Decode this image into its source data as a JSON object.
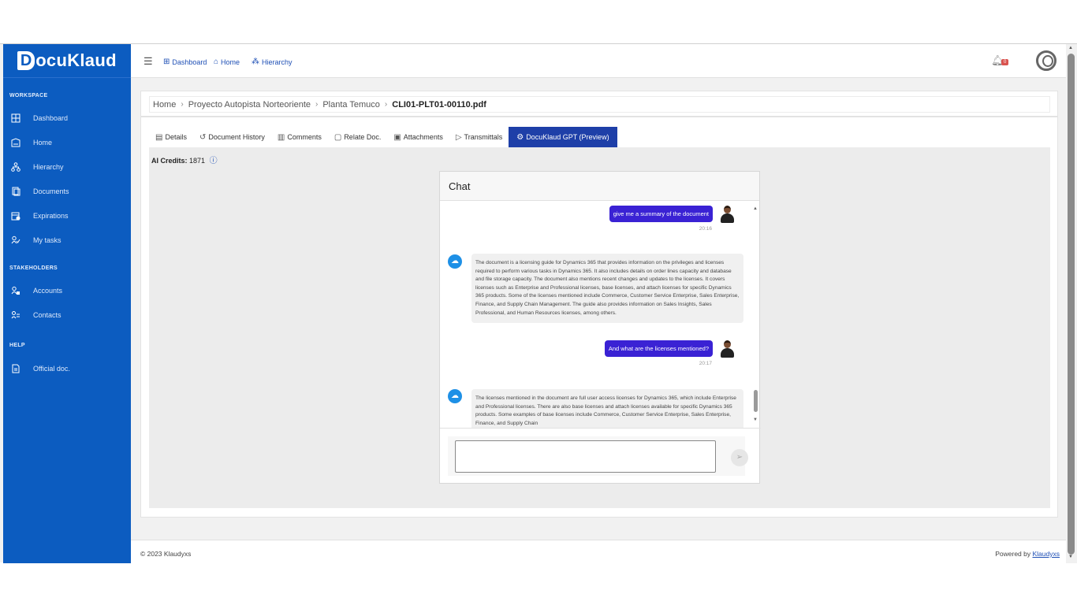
{
  "brand": {
    "name": "DocuKlaud",
    "initial": "D",
    "rest": "ocuKlaud"
  },
  "sidebar": {
    "sections": [
      {
        "title": "WORKSPACE",
        "items": [
          {
            "label": "Dashboard",
            "icon": "dashboard-icon"
          },
          {
            "label": "Home",
            "icon": "home-icon"
          },
          {
            "label": "Hierarchy",
            "icon": "hierarchy-icon"
          },
          {
            "label": "Documents",
            "icon": "documents-icon"
          },
          {
            "label": "Expirations",
            "icon": "expirations-icon"
          },
          {
            "label": "My tasks",
            "icon": "tasks-icon"
          }
        ]
      },
      {
        "title": "STAKEHOLDERS",
        "items": [
          {
            "label": "Accounts",
            "icon": "accounts-icon"
          },
          {
            "label": "Contacts",
            "icon": "contacts-icon"
          }
        ]
      },
      {
        "title": "HELP",
        "items": [
          {
            "label": "Official doc.",
            "icon": "document-icon"
          }
        ]
      }
    ]
  },
  "topbar": {
    "links": [
      {
        "label": "Dashboard",
        "icon": "dashboard-icon"
      },
      {
        "label": "Home",
        "icon": "home-icon"
      },
      {
        "label": "Hierarchy",
        "icon": "hierarchy-icon"
      }
    ],
    "notification_count": "0"
  },
  "breadcrumb": [
    "Home",
    "Proyecto Autopista Norteoriente",
    "Planta Temuco",
    "CLI01-PLT01-00110.pdf"
  ],
  "tabs": [
    {
      "label": "Details",
      "icon": "details-icon",
      "active": false
    },
    {
      "label": "Document History",
      "icon": "history-icon",
      "active": false
    },
    {
      "label": "Comments",
      "icon": "comments-icon",
      "active": false
    },
    {
      "label": "Relate Doc.",
      "icon": "relate-icon",
      "active": false
    },
    {
      "label": "Attachments",
      "icon": "attachments-icon",
      "active": false
    },
    {
      "label": "Transmittals",
      "icon": "send-icon",
      "active": false
    },
    {
      "label": "DocuKlaud GPT (Preview)",
      "icon": "gpt-icon",
      "active": true
    }
  ],
  "credits": {
    "label": "AI Credits:",
    "value": "1871"
  },
  "chat": {
    "title": "Chat",
    "messages": [
      {
        "role": "user",
        "text": "give me a summary of the document",
        "time": "20:16"
      },
      {
        "role": "bot",
        "text": "The document is a licensing guide for Dynamics 365 that provides information on the privileges and licenses required to perform various tasks in Dynamics 365. It also includes details on order lines capacity and database and file storage capacity. The document also mentions recent changes and updates to the licenses. It covers licenses such as Enterprise and Professional licenses, base licenses, and attach licenses for specific Dynamics 365 products. Some of the licenses mentioned include Commerce, Customer Service Enterprise, Sales Enterprise, Finance, and Supply Chain Management. The guide also provides information on Sales Insights, Sales Professional, and Human Resources licenses, among others."
      },
      {
        "role": "user",
        "text": "And what are the licenses mentioned?",
        "time": "20:17"
      },
      {
        "role": "bot",
        "text": "The licenses mentioned in the document are full user access licenses for Dynamics 365, which include Enterprise and Professional licenses. There are also base licenses and attach licenses available for specific Dynamics 365 products. Some examples of base licenses include Commerce, Customer Service Enterprise, Sales Enterprise, Finance, and Supply Chain"
      }
    ],
    "input_value": ""
  },
  "footer": {
    "copyright": "© 2023 Klaudyxs",
    "powered_prefix": "Powered by",
    "powered_link": "Klaudyxs"
  },
  "colors": {
    "sidebar": "#0c5cc0",
    "active_tab": "#1e3fa8",
    "user_bubble": "#3a22d4",
    "bot_avatar": "#1e90e6"
  }
}
